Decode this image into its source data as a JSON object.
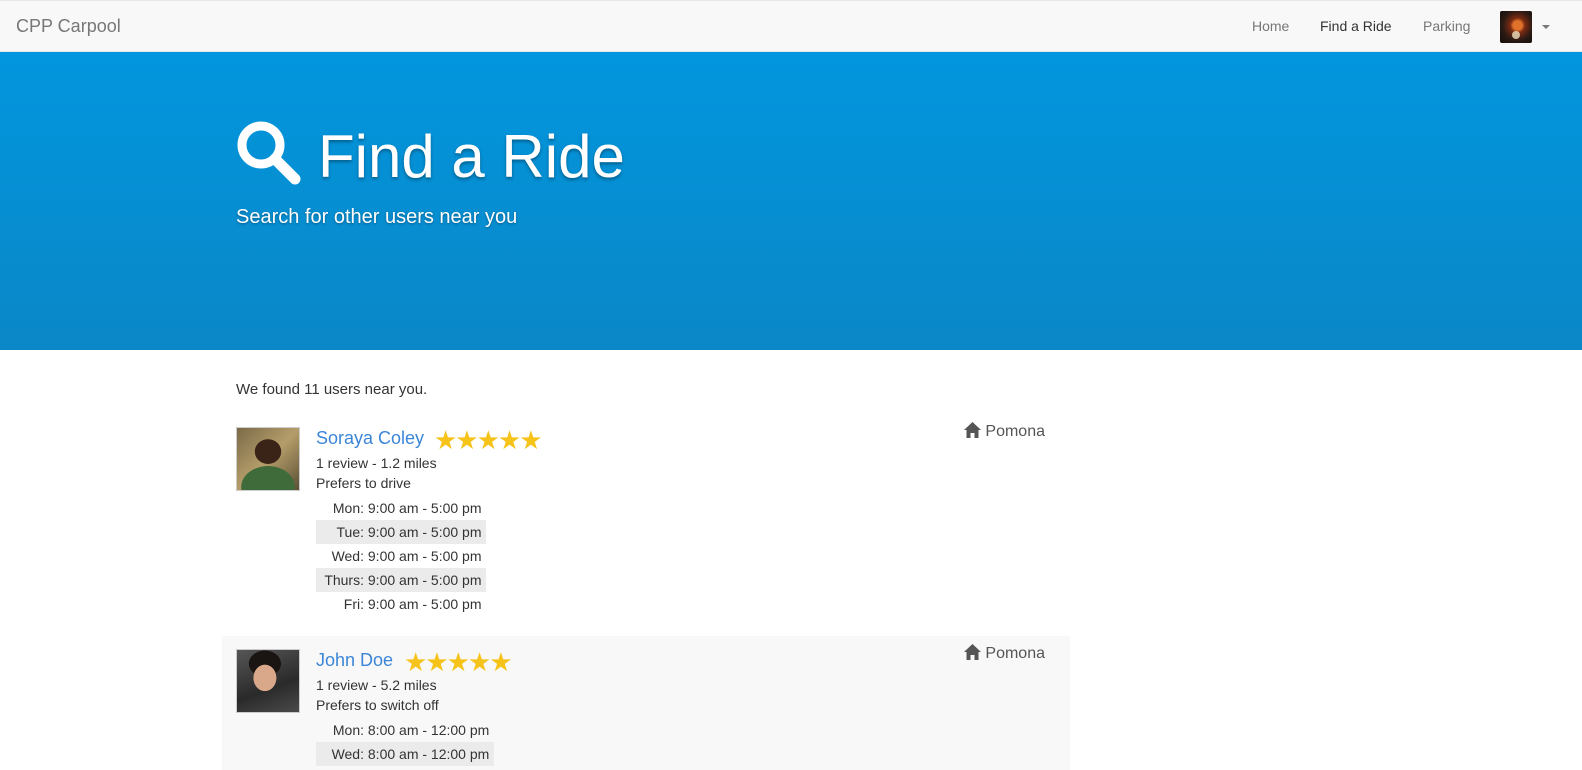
{
  "navbar": {
    "brand": "CPP Carpool",
    "links": [
      {
        "label": "Home",
        "active": false
      },
      {
        "label": "Find a Ride",
        "active": true
      },
      {
        "label": "Parking",
        "active": false
      }
    ]
  },
  "hero": {
    "icon": "search-icon",
    "title": "Find a Ride",
    "subtitle": "Search for other users near you",
    "bg_color": "#0296de"
  },
  "results": {
    "summary": "We found 11 users near you.",
    "users": [
      {
        "name": "Soraya Coley",
        "stars": "★★★★★",
        "rating": 5,
        "reviews_distance": "1 review - 1.2 miles",
        "preference": "Prefers to drive",
        "location": "Pomona",
        "schedule": [
          {
            "day": "Mon:",
            "time": "9:00 am - 5:00 pm"
          },
          {
            "day": "Tue:",
            "time": "9:00 am - 5:00 pm"
          },
          {
            "day": "Wed:",
            "time": "9:00 am - 5:00 pm"
          },
          {
            "day": "Thurs:",
            "time": "9:00 am - 5:00 pm"
          },
          {
            "day": "Fri:",
            "time": "9:00 am - 5:00 pm"
          }
        ]
      },
      {
        "name": "John Doe",
        "stars": "★★★★★",
        "rating": 5,
        "reviews_distance": "1 review - 5.2 miles",
        "preference": "Prefers to switch off",
        "location": "Pomona",
        "schedule": [
          {
            "day": "Mon:",
            "time": "8:00 am - 12:00 pm"
          },
          {
            "day": "Wed:",
            "time": "8:00 am - 12:00 pm"
          }
        ]
      }
    ]
  },
  "colors": {
    "link": "#3b86d8",
    "star": "#f6c31b"
  }
}
